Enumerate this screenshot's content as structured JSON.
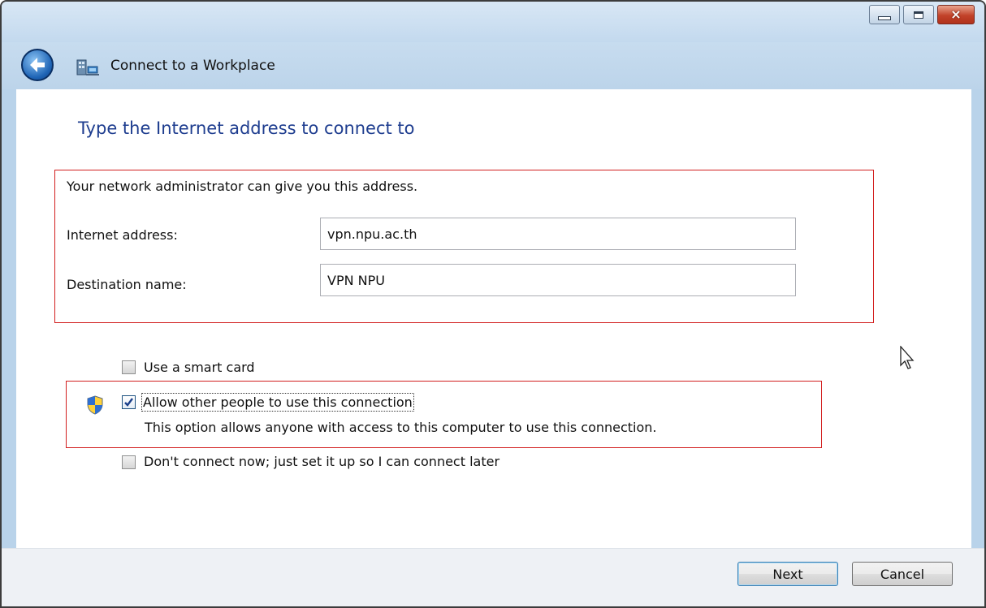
{
  "window": {
    "title": "Connect to a Workplace",
    "controls": {
      "minimize": "minimize",
      "maximize": "maximize",
      "close": "×"
    }
  },
  "page": {
    "main_instruction": "Type the Internet address to connect to",
    "hint": "Your network administrator can give you this address.",
    "internet_address": {
      "label": "Internet address:",
      "value": "vpn.npu.ac.th"
    },
    "destination_name": {
      "label": "Destination name:",
      "value": "VPN NPU"
    },
    "options": [
      {
        "label": "Use a smart card",
        "checked": false
      },
      {
        "label": "Allow other people to use this connection",
        "checked": true,
        "description": "This option allows anyone with access to this computer to use this connection.",
        "requires_admin": true
      },
      {
        "label": "Don't connect now; just set it up so I can connect later",
        "checked": false
      }
    ]
  },
  "buttons": {
    "next": "Next",
    "cancel": "Cancel"
  },
  "colors": {
    "instruction": "#1e3d8f",
    "highlight_box": "#d21e1e",
    "chrome": "#b9d3ea"
  },
  "icons": [
    "back-arrow-icon",
    "network-workplace-icon",
    "uac-shield-icon",
    "checkbox-check-icon",
    "mouse-pointer-icon"
  ]
}
